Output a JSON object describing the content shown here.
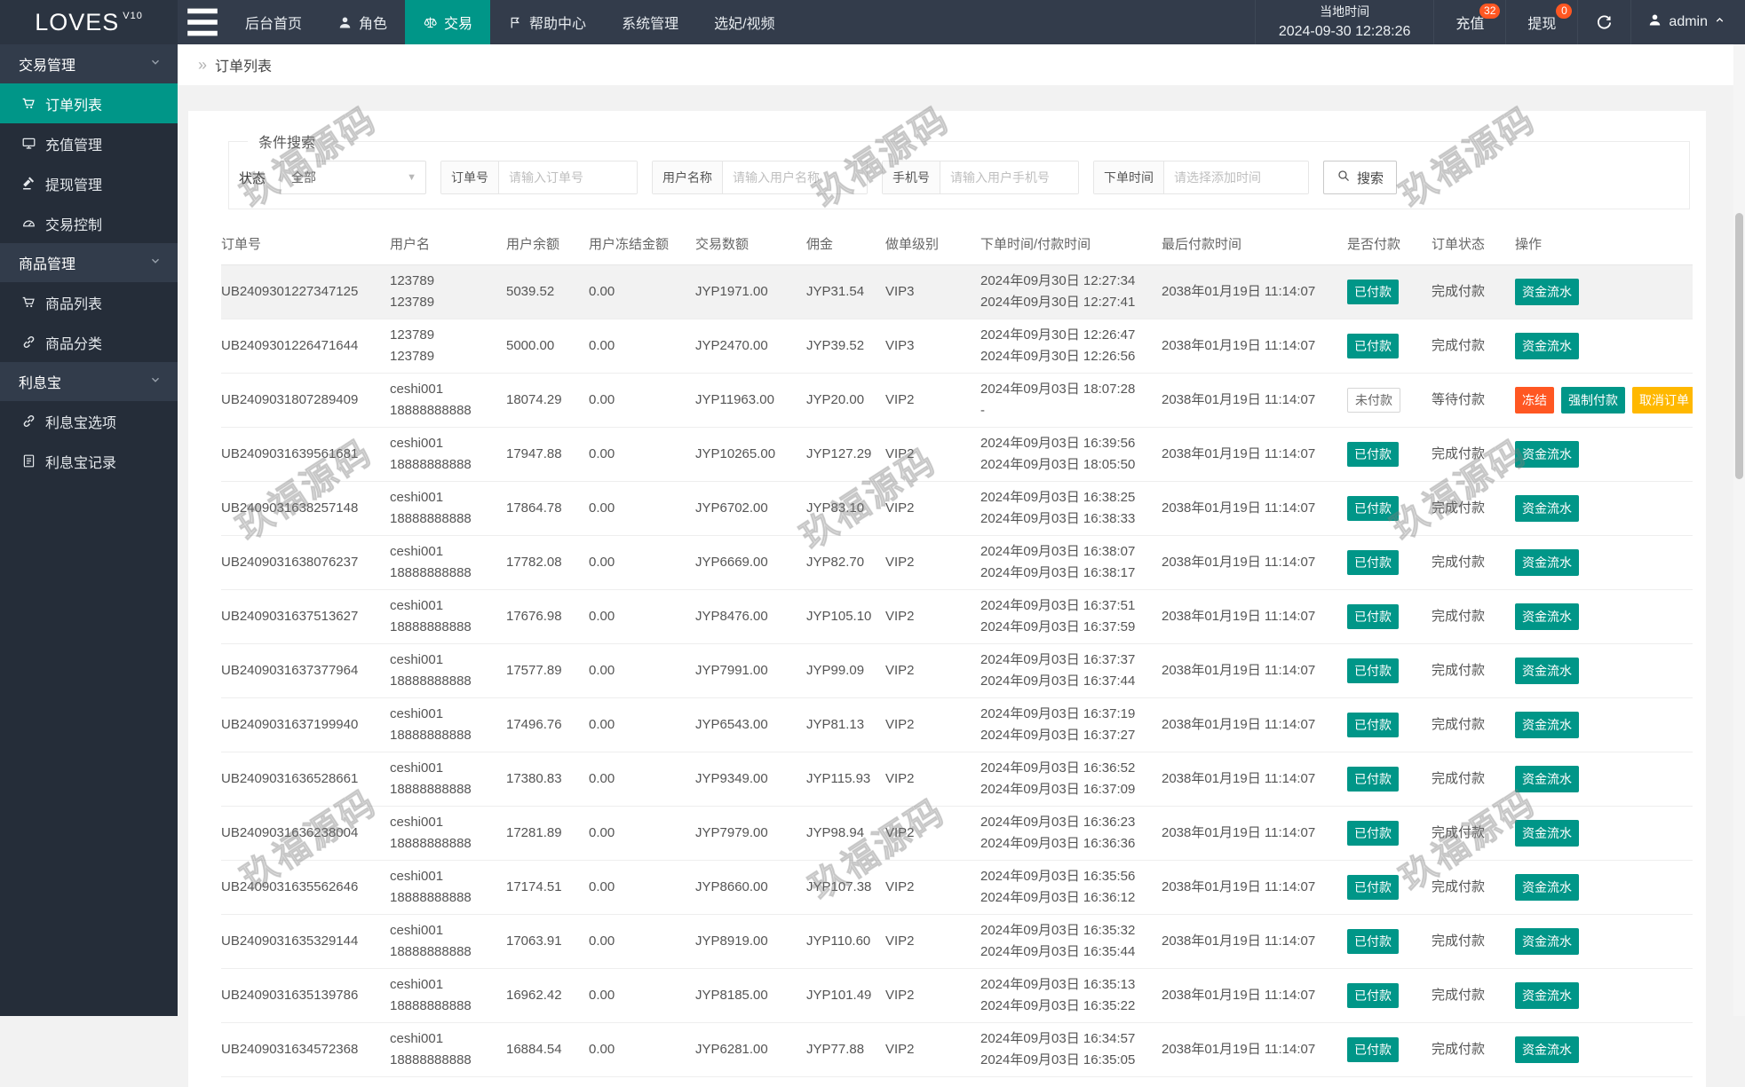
{
  "brand": {
    "name": "LOVES",
    "version": "V10"
  },
  "navbar": {
    "menu": [
      {
        "label": "后台首页",
        "icon": null,
        "active": false
      },
      {
        "label": "角色",
        "icon": "user",
        "active": false
      },
      {
        "label": "交易",
        "icon": "scales",
        "active": true
      },
      {
        "label": "帮助中心",
        "icon": "flag",
        "active": false
      },
      {
        "label": "系统管理",
        "icon": null,
        "active": false
      },
      {
        "label": "选妃/视频",
        "icon": null,
        "active": false
      }
    ],
    "time_label": "当地时间",
    "time_value": "2024-09-30 12:28:26",
    "recharge": {
      "label": "充值",
      "badge": "32"
    },
    "withdraw": {
      "label": "提现",
      "badge": "0"
    },
    "username": "admin"
  },
  "sidebar": {
    "groups": [
      {
        "label": "交易管理",
        "items": [
          {
            "label": "订单列表",
            "icon": "cart",
            "active": true
          },
          {
            "label": "充值管理",
            "icon": "card",
            "active": false
          },
          {
            "label": "提现管理",
            "icon": "hammer",
            "active": false
          },
          {
            "label": "交易控制",
            "icon": "gauge",
            "active": false
          }
        ]
      },
      {
        "label": "商品管理",
        "items": [
          {
            "label": "商品列表",
            "icon": "cart",
            "active": false
          },
          {
            "label": "商品分类",
            "icon": "link",
            "active": false
          }
        ]
      },
      {
        "label": "利息宝",
        "items": [
          {
            "label": "利息宝选项",
            "icon": "link",
            "active": false
          },
          {
            "label": "利息宝记录",
            "icon": "doc",
            "active": false
          }
        ]
      }
    ]
  },
  "breadcrumb": {
    "chevron": "»",
    "title": "订单列表"
  },
  "search": {
    "legend": "条件搜索",
    "status_label": "状态",
    "status_value": "全部",
    "fields": [
      {
        "label": "订单号",
        "placeholder": "请输入订单号"
      },
      {
        "label": "用户名称",
        "placeholder": "请输入用户名称"
      },
      {
        "label": "手机号",
        "placeholder": "请输入用户手机号"
      },
      {
        "label": "下单时间",
        "placeholder": "请选择添加时间"
      }
    ],
    "button": "搜索"
  },
  "table": {
    "columns": [
      "订单号",
      "用户名",
      "用户余额",
      "用户冻结金额",
      "交易数额",
      "佣金",
      "做单级别",
      "下单时间/付款时间",
      "最后付款时间",
      "是否付款",
      "订单状态",
      "操作"
    ],
    "rows": [
      {
        "order_no": "UB2409301227347125",
        "user": [
          "123789",
          "123789"
        ],
        "balance": "5039.52",
        "frozen": "0.00",
        "amount": "JYP1971.00",
        "commission": "JYP31.54",
        "level": "VIP3",
        "times": [
          "2024年09月30日 12:27:34",
          "2024年09月30日 12:27:41"
        ],
        "last_time": "2038年01月19日 11:14:07",
        "paid": {
          "label": "已付款",
          "filled": true
        },
        "status": "完成付款",
        "actions": [
          {
            "label": "资金流水",
            "style": "teal"
          }
        ],
        "highlighted": true
      },
      {
        "order_no": "UB2409301226471644",
        "user": [
          "123789",
          "123789"
        ],
        "balance": "5000.00",
        "frozen": "0.00",
        "amount": "JYP2470.00",
        "commission": "JYP39.52",
        "level": "VIP3",
        "times": [
          "2024年09月30日 12:26:47",
          "2024年09月30日 12:26:56"
        ],
        "last_time": "2038年01月19日 11:14:07",
        "paid": {
          "label": "已付款",
          "filled": true
        },
        "status": "完成付款",
        "actions": [
          {
            "label": "资金流水",
            "style": "teal"
          }
        ],
        "highlighted": false
      },
      {
        "order_no": "UB2409031807289409",
        "user": [
          "ceshi001",
          "18888888888"
        ],
        "balance": "18074.29",
        "frozen": "0.00",
        "amount": "JYP11963.00",
        "commission": "JYP20.00",
        "level": "VIP2",
        "times": [
          "2024年09月03日 18:07:28",
          "-"
        ],
        "last_time": "2038年01月19日 11:14:07",
        "paid": {
          "label": "未付款",
          "filled": false
        },
        "status": "等待付款",
        "actions": [
          {
            "label": "冻结",
            "style": "red"
          },
          {
            "label": "强制付款",
            "style": "teal"
          },
          {
            "label": "取消订单",
            "style": "yellow"
          }
        ],
        "highlighted": false
      },
      {
        "order_no": "UB2409031639561681",
        "user": [
          "ceshi001",
          "18888888888"
        ],
        "balance": "17947.88",
        "frozen": "0.00",
        "amount": "JYP10265.00",
        "commission": "JYP127.29",
        "level": "VIP2",
        "times": [
          "2024年09月03日 16:39:56",
          "2024年09月03日 18:05:50"
        ],
        "last_time": "2038年01月19日 11:14:07",
        "paid": {
          "label": "已付款",
          "filled": true
        },
        "status": "完成付款",
        "actions": [
          {
            "label": "资金流水",
            "style": "teal"
          }
        ],
        "highlighted": false
      },
      {
        "order_no": "UB2409031638257148",
        "user": [
          "ceshi001",
          "18888888888"
        ],
        "balance": "17864.78",
        "frozen": "0.00",
        "amount": "JYP6702.00",
        "commission": "JYP83.10",
        "level": "VIP2",
        "times": [
          "2024年09月03日 16:38:25",
          "2024年09月03日 16:38:33"
        ],
        "last_time": "2038年01月19日 11:14:07",
        "paid": {
          "label": "已付款",
          "filled": true
        },
        "status": "完成付款",
        "actions": [
          {
            "label": "资金流水",
            "style": "teal"
          }
        ],
        "highlighted": false
      },
      {
        "order_no": "UB2409031638076237",
        "user": [
          "ceshi001",
          "18888888888"
        ],
        "balance": "17782.08",
        "frozen": "0.00",
        "amount": "JYP6669.00",
        "commission": "JYP82.70",
        "level": "VIP2",
        "times": [
          "2024年09月03日 16:38:07",
          "2024年09月03日 16:38:17"
        ],
        "last_time": "2038年01月19日 11:14:07",
        "paid": {
          "label": "已付款",
          "filled": true
        },
        "status": "完成付款",
        "actions": [
          {
            "label": "资金流水",
            "style": "teal"
          }
        ],
        "highlighted": false
      },
      {
        "order_no": "UB2409031637513627",
        "user": [
          "ceshi001",
          "18888888888"
        ],
        "balance": "17676.98",
        "frozen": "0.00",
        "amount": "JYP8476.00",
        "commission": "JYP105.10",
        "level": "VIP2",
        "times": [
          "2024年09月03日 16:37:51",
          "2024年09月03日 16:37:59"
        ],
        "last_time": "2038年01月19日 11:14:07",
        "paid": {
          "label": "已付款",
          "filled": true
        },
        "status": "完成付款",
        "actions": [
          {
            "label": "资金流水",
            "style": "teal"
          }
        ],
        "highlighted": false
      },
      {
        "order_no": "UB2409031637377964",
        "user": [
          "ceshi001",
          "18888888888"
        ],
        "balance": "17577.89",
        "frozen": "0.00",
        "amount": "JYP7991.00",
        "commission": "JYP99.09",
        "level": "VIP2",
        "times": [
          "2024年09月03日 16:37:37",
          "2024年09月03日 16:37:44"
        ],
        "last_time": "2038年01月19日 11:14:07",
        "paid": {
          "label": "已付款",
          "filled": true
        },
        "status": "完成付款",
        "actions": [
          {
            "label": "资金流水",
            "style": "teal"
          }
        ],
        "highlighted": false
      },
      {
        "order_no": "UB2409031637199940",
        "user": [
          "ceshi001",
          "18888888888"
        ],
        "balance": "17496.76",
        "frozen": "0.00",
        "amount": "JYP6543.00",
        "commission": "JYP81.13",
        "level": "VIP2",
        "times": [
          "2024年09月03日 16:37:19",
          "2024年09月03日 16:37:27"
        ],
        "last_time": "2038年01月19日 11:14:07",
        "paid": {
          "label": "已付款",
          "filled": true
        },
        "status": "完成付款",
        "actions": [
          {
            "label": "资金流水",
            "style": "teal"
          }
        ],
        "highlighted": false
      },
      {
        "order_no": "UB2409031636528661",
        "user": [
          "ceshi001",
          "18888888888"
        ],
        "balance": "17380.83",
        "frozen": "0.00",
        "amount": "JYP9349.00",
        "commission": "JYP115.93",
        "level": "VIP2",
        "times": [
          "2024年09月03日 16:36:52",
          "2024年09月03日 16:37:09"
        ],
        "last_time": "2038年01月19日 11:14:07",
        "paid": {
          "label": "已付款",
          "filled": true
        },
        "status": "完成付款",
        "actions": [
          {
            "label": "资金流水",
            "style": "teal"
          }
        ],
        "highlighted": false
      },
      {
        "order_no": "UB2409031636238004",
        "user": [
          "ceshi001",
          "18888888888"
        ],
        "balance": "17281.89",
        "frozen": "0.00",
        "amount": "JYP7979.00",
        "commission": "JYP98.94",
        "level": "VIP2",
        "times": [
          "2024年09月03日 16:36:23",
          "2024年09月03日 16:36:36"
        ],
        "last_time": "2038年01月19日 11:14:07",
        "paid": {
          "label": "已付款",
          "filled": true
        },
        "status": "完成付款",
        "actions": [
          {
            "label": "资金流水",
            "style": "teal"
          }
        ],
        "highlighted": false
      },
      {
        "order_no": "UB2409031635562646",
        "user": [
          "ceshi001",
          "18888888888"
        ],
        "balance": "17174.51",
        "frozen": "0.00",
        "amount": "JYP8660.00",
        "commission": "JYP107.38",
        "level": "VIP2",
        "times": [
          "2024年09月03日 16:35:56",
          "2024年09月03日 16:36:12"
        ],
        "last_time": "2038年01月19日 11:14:07",
        "paid": {
          "label": "已付款",
          "filled": true
        },
        "status": "完成付款",
        "actions": [
          {
            "label": "资金流水",
            "style": "teal"
          }
        ],
        "highlighted": false
      },
      {
        "order_no": "UB2409031635329144",
        "user": [
          "ceshi001",
          "18888888888"
        ],
        "balance": "17063.91",
        "frozen": "0.00",
        "amount": "JYP8919.00",
        "commission": "JYP110.60",
        "level": "VIP2",
        "times": [
          "2024年09月03日 16:35:32",
          "2024年09月03日 16:35:44"
        ],
        "last_time": "2038年01月19日 11:14:07",
        "paid": {
          "label": "已付款",
          "filled": true
        },
        "status": "完成付款",
        "actions": [
          {
            "label": "资金流水",
            "style": "teal"
          }
        ],
        "highlighted": false
      },
      {
        "order_no": "UB2409031635139786",
        "user": [
          "ceshi001",
          "18888888888"
        ],
        "balance": "16962.42",
        "frozen": "0.00",
        "amount": "JYP8185.00",
        "commission": "JYP101.49",
        "level": "VIP2",
        "times": [
          "2024年09月03日 16:35:13",
          "2024年09月03日 16:35:22"
        ],
        "last_time": "2038年01月19日 11:14:07",
        "paid": {
          "label": "已付款",
          "filled": true
        },
        "status": "完成付款",
        "actions": [
          {
            "label": "资金流水",
            "style": "teal"
          }
        ],
        "highlighted": false
      },
      {
        "order_no": "UB2409031634572368",
        "user": [
          "ceshi001",
          "18888888888"
        ],
        "balance": "16884.54",
        "frozen": "0.00",
        "amount": "JYP6281.00",
        "commission": "JYP77.88",
        "level": "VIP2",
        "times": [
          "2024年09月03日 16:34:57",
          "2024年09月03日 16:35:05"
        ],
        "last_time": "2038年01月19日 11:14:07",
        "paid": {
          "label": "已付款",
          "filled": true
        },
        "status": "完成付款",
        "actions": [
          {
            "label": "资金流水",
            "style": "teal"
          }
        ],
        "highlighted": false
      }
    ]
  },
  "watermark": {
    "text": "玖福源码"
  },
  "colors": {
    "accent": "#009688",
    "danger": "#FF5722",
    "warning": "#FFB800",
    "badge": "#FF5722",
    "navbar": "#333C4B",
    "sidebar": "#252D39"
  }
}
